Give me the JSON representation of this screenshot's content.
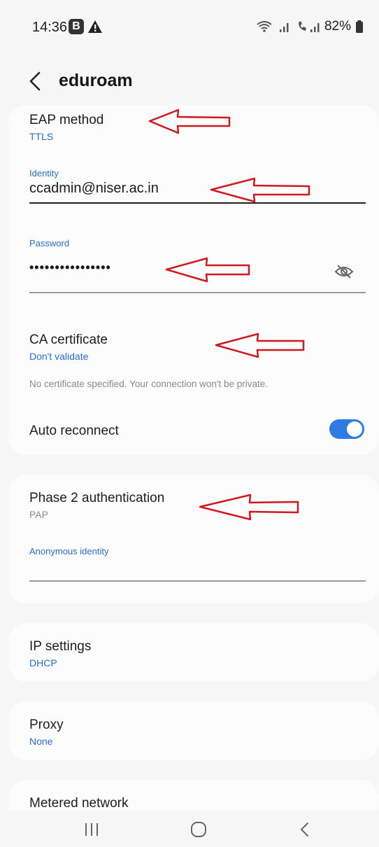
{
  "status_bar": {
    "time": "14:36",
    "badge": "B",
    "battery": "82%"
  },
  "header": {
    "title": "eduroam"
  },
  "security": {
    "eap_label": "EAP method",
    "eap_value": "TTLS",
    "identity_label": "Identity",
    "identity_value": "ccadmin@niser.ac.in",
    "password_label": "Password",
    "password_value": "••••••••••••••••",
    "ca_label": "CA certificate",
    "ca_value": "Don't validate",
    "ca_note": "No certificate specified. Your connection won't be private.",
    "auto_reconnect_label": "Auto reconnect",
    "auto_reconnect_on": true
  },
  "phase2": {
    "label": "Phase 2 authentication",
    "value": "PAP",
    "anon_label": "Anonymous identity",
    "anon_value": ""
  },
  "ip": {
    "label": "IP settings",
    "value": "DHCP"
  },
  "proxy": {
    "label": "Proxy",
    "value": "None"
  },
  "metered": {
    "label": "Metered network"
  },
  "colors": {
    "accent": "#2c7be5",
    "annotation_arrow": "#d0191f",
    "link_text": "#2a6dd3"
  },
  "icons": [
    "back-chevron-icon",
    "eye-off-icon",
    "recent-apps-icon",
    "home-icon",
    "back-nav-icon",
    "wifi-icon",
    "signal-icon",
    "battery-icon",
    "alert-icon"
  ]
}
